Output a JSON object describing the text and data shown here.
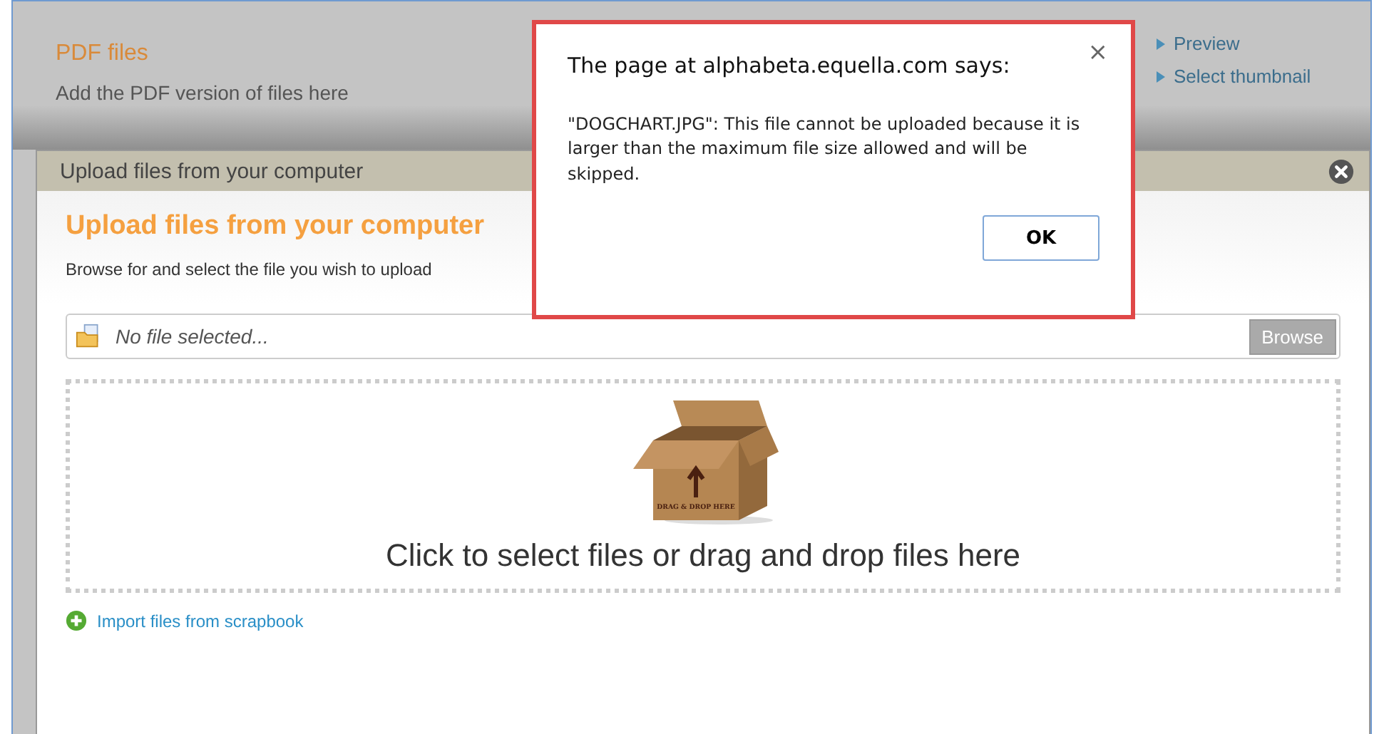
{
  "page": {
    "section_title": "PDF files",
    "section_description": "Add the PDF version of files here",
    "side_links": [
      "Preview",
      "Select thumbnail"
    ]
  },
  "upload_modal": {
    "title": "Upload files from your computer",
    "heading": "Upload files from your computer",
    "instructions": "Browse for and select the file you wish to upload",
    "file_field": {
      "placeholder": "No file selected..."
    },
    "browse_button": "Browse",
    "drop_zone": {
      "box_label": "DRAG & DROP HERE",
      "text": "Click to select files or drag and drop files here"
    },
    "import_link": "Import files from scrapbook"
  },
  "alert": {
    "title": "The page at alphabeta.equella.com says:",
    "message": "\"DOGCHART.JPG\": This file cannot be uploaded because it is larger than the maximum file size allowed and will be skipped.",
    "close": "×",
    "button": "OK"
  }
}
